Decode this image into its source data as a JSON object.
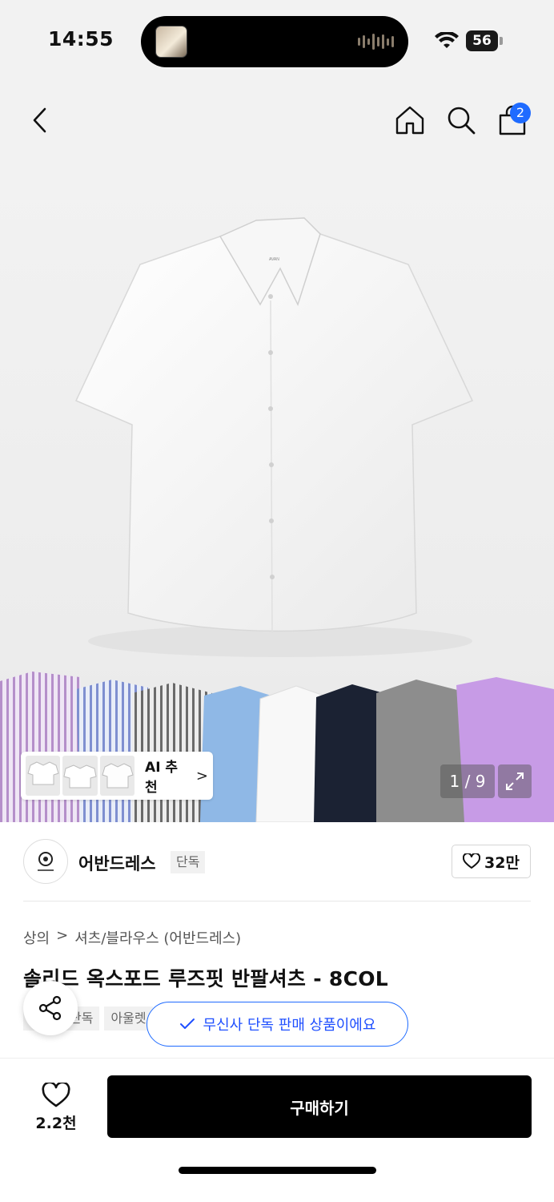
{
  "status_bar": {
    "time": "14:55",
    "battery": "56"
  },
  "nav": {
    "cart_count": "2"
  },
  "hero": {
    "ai_label": "AI 추천",
    "ai_chevron": ">",
    "page_counter": "1 / 9"
  },
  "brand": {
    "name": "어반드레스",
    "tag": "단독",
    "likes": "32만"
  },
  "breadcrumb": {
    "items": [
      "상의",
      "셔츠/블라우스 (어반드레스)"
    ],
    "separator": ">"
  },
  "product": {
    "title": "솔리드 옥스포드 루즈핏 반팔셔츠 - 8COL",
    "tags": [
      "단독",
      "아울렛"
    ]
  },
  "toast": {
    "text": "무신사 단독 판매 상품이에요"
  },
  "bottom": {
    "wish_count": "2.2천",
    "buy_label": "구매하기"
  },
  "colors": {
    "accent": "#1f6bff",
    "buy_bg": "#000000"
  }
}
